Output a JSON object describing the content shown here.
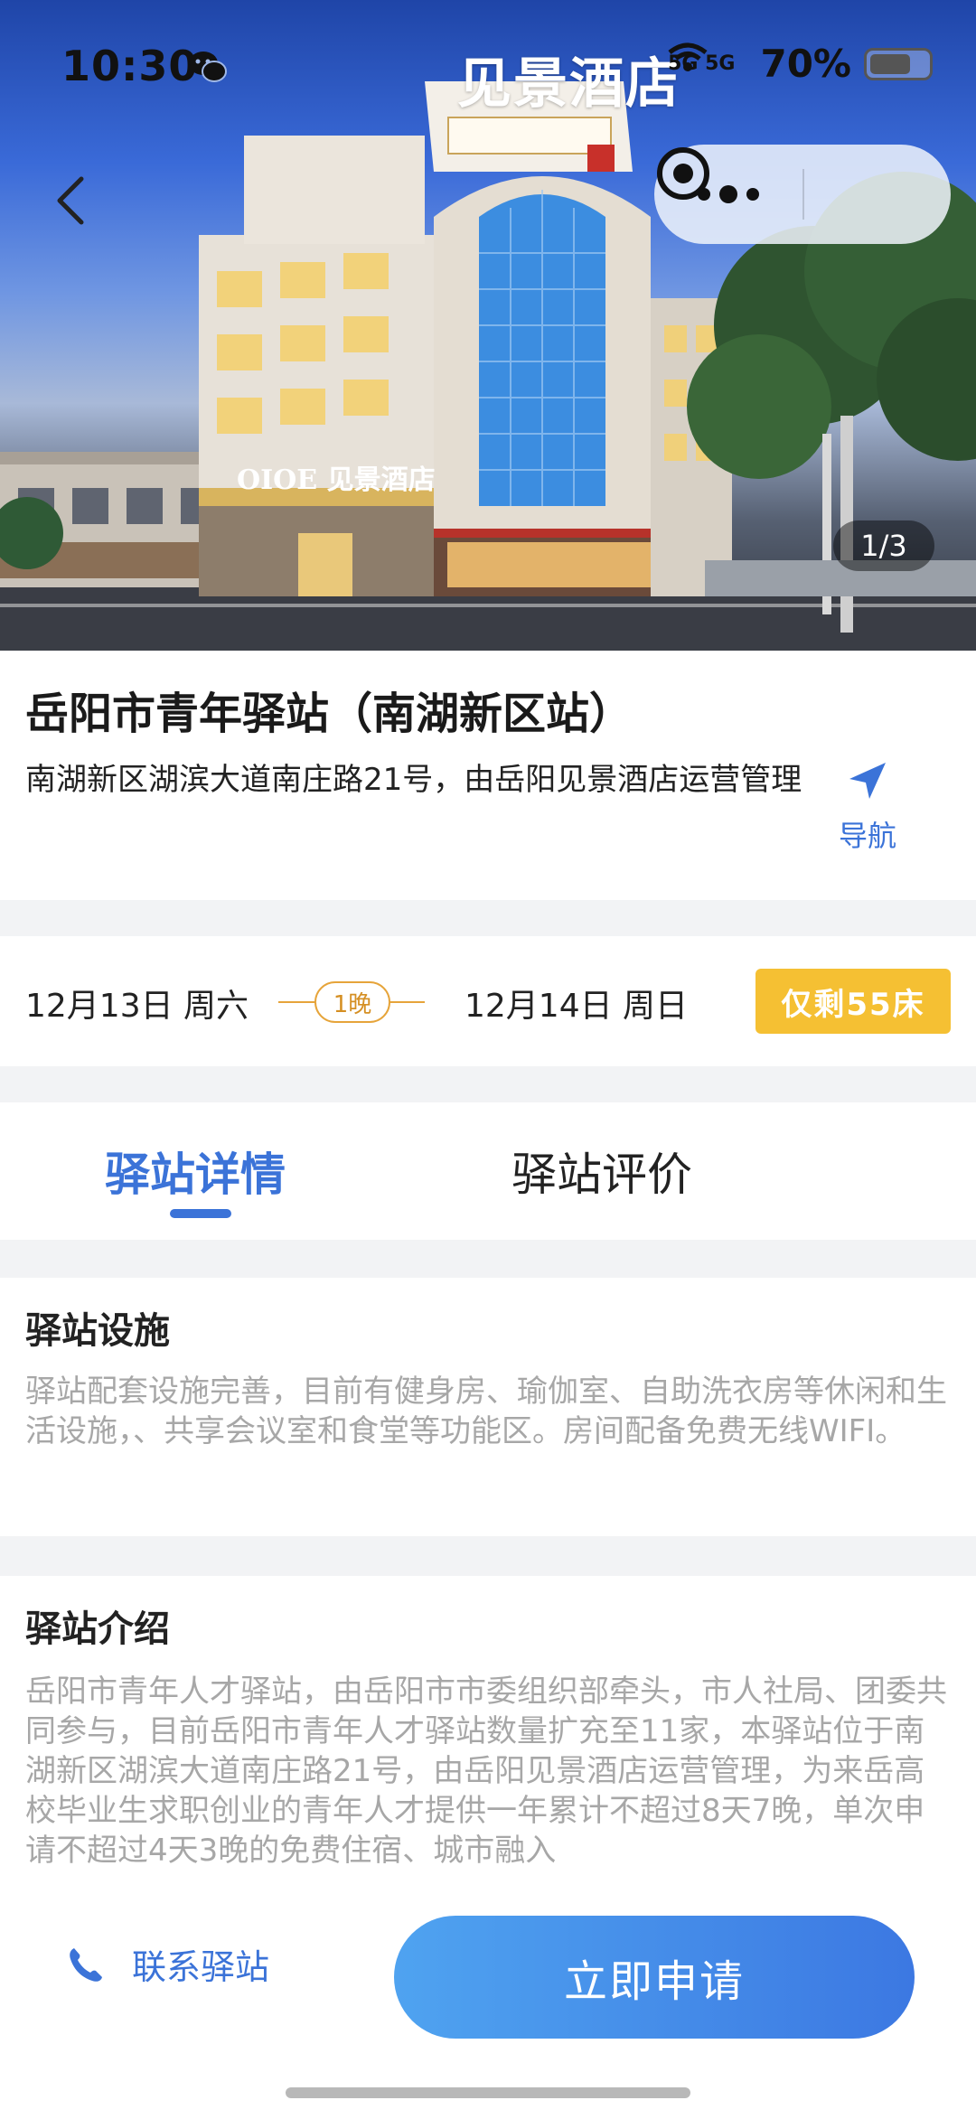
{
  "status_bar": {
    "time": "10:30",
    "network": "5G  5G",
    "battery": "70%"
  },
  "hero": {
    "photo_counter": "1/3",
    "sign_text": "见景酒店",
    "storefront_sign": "OIOE 见景酒店"
  },
  "station": {
    "title": "岳阳市青年驿站（南湖新区站）",
    "address": "南湖新区湖滨大道南庄路21号，由岳阳见景酒店运营管理",
    "nav_label": "导航"
  },
  "booking": {
    "checkin": "12月13日 周六",
    "nights": "1晚",
    "checkout": "12月14日 周日",
    "beds_left": "仅剩55床"
  },
  "tabs": [
    {
      "label": "驿站详情",
      "active": true
    },
    {
      "label": "驿站评价",
      "active": false
    }
  ],
  "facilities": {
    "title": "驿站设施",
    "body": "驿站配套设施完善，目前有健身房、瑜伽室、自助洗衣房等休闲和生活设施，、共享会议室和食堂等功能区。房间配备免费无线WIFI。"
  },
  "intro": {
    "title": "驿站介绍",
    "body": "岳阳市青年人才驿站，由岳阳市市委组织部牵头，市人社局、团委共同参与，目前岳阳市青年人才驿站数量扩充至11家，本驿站位于南湖新区湖滨大道南庄路21号，由岳阳见景酒店运营管理，为来岳高校毕业生求职创业的青年人才提供一年累计不超过8天7晚，单次申请不超过4天3晚的免费住宿、城市融入"
  },
  "footer": {
    "contact_label": "联系驿站",
    "apply_label": "立即申请"
  },
  "colors": {
    "accent": "#3b73d8",
    "badge": "#f5c033",
    "nights_border": "#e6a43a"
  }
}
